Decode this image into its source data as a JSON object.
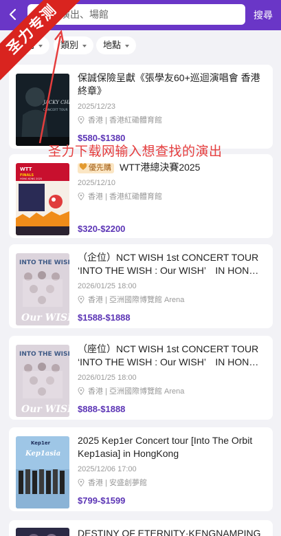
{
  "header": {
    "back_label": "‹",
    "search_placeholder": "演出、場館",
    "search_button": "搜尋",
    "accent_color": "#6a36c7"
  },
  "filters": [
    {
      "label": "時間"
    },
    {
      "label": "類別"
    },
    {
      "label": "地點"
    }
  ],
  "events": [
    {
      "title": "保誠保險呈獻《張學友60+巡迴演唱會 香港終章》",
      "tag": "",
      "date": "2025/12/23",
      "venue": "香港 | 香港紅磡體育館",
      "price": "$580-$1380",
      "poster": "jacky-cheung-60-poster"
    },
    {
      "title": "WTT港總決賽2025",
      "tag": "優先購",
      "date": "2025/12/10",
      "venue": "香港 | 香港紅磡體育館",
      "price": "$320-$2200",
      "poster": "wtt-finals-poster"
    },
    {
      "title": "（企位）NCT WISH 1st CONCERT TOUR ‘INTO THE WISH : Our WISH’　IN HONG KONG",
      "tag": "",
      "date": "2026/01/25 18:00",
      "venue": "香港 | 亞洲國際博覽館 Arena",
      "price": "$1588-$1888",
      "poster": "nct-wish-poster"
    },
    {
      "title": "（座位）NCT WISH 1st CONCERT TOUR ‘INTO THE WISH : Our WISH’　IN HONG KONG",
      "tag": "",
      "date": "2026/01/25 18:00",
      "venue": "香港 | 亞洲國際博覽館 Arena",
      "price": "$888-$1888",
      "poster": "nct-wish-poster"
    },
    {
      "title": "2025 Kep1er Concert tour [Into The Orbit Kep1asia] in HongKong",
      "tag": "",
      "date": "2025/12/06 17:00",
      "venue": "香港 | 安盛創夢館",
      "price": "$799-$1599",
      "poster": "kep1er-poster"
    },
    {
      "title": "DESTINY OF ETERNITY·KENGNAMPING",
      "tag": "",
      "date": "",
      "venue": "",
      "price": "",
      "poster": "destiny-poster"
    }
  ],
  "poster_texts": {
    "p1_line1": "JACKY CHEUNG 60+",
    "p1_line2": "CONCERT TOUR",
    "p2_line1": "WTT",
    "p2_line2": "FINALS",
    "p2_line3": "HONG KONG 2025",
    "p3_line1": "INTO THE WISH",
    "p3_line2": "Our WISH",
    "p5_line1": "Kep1er",
    "p5_line2": "Kep1asia"
  },
  "watermark": {
    "corner": "圣力专测",
    "overlay": "圣力下载网输入想查找的演出"
  }
}
